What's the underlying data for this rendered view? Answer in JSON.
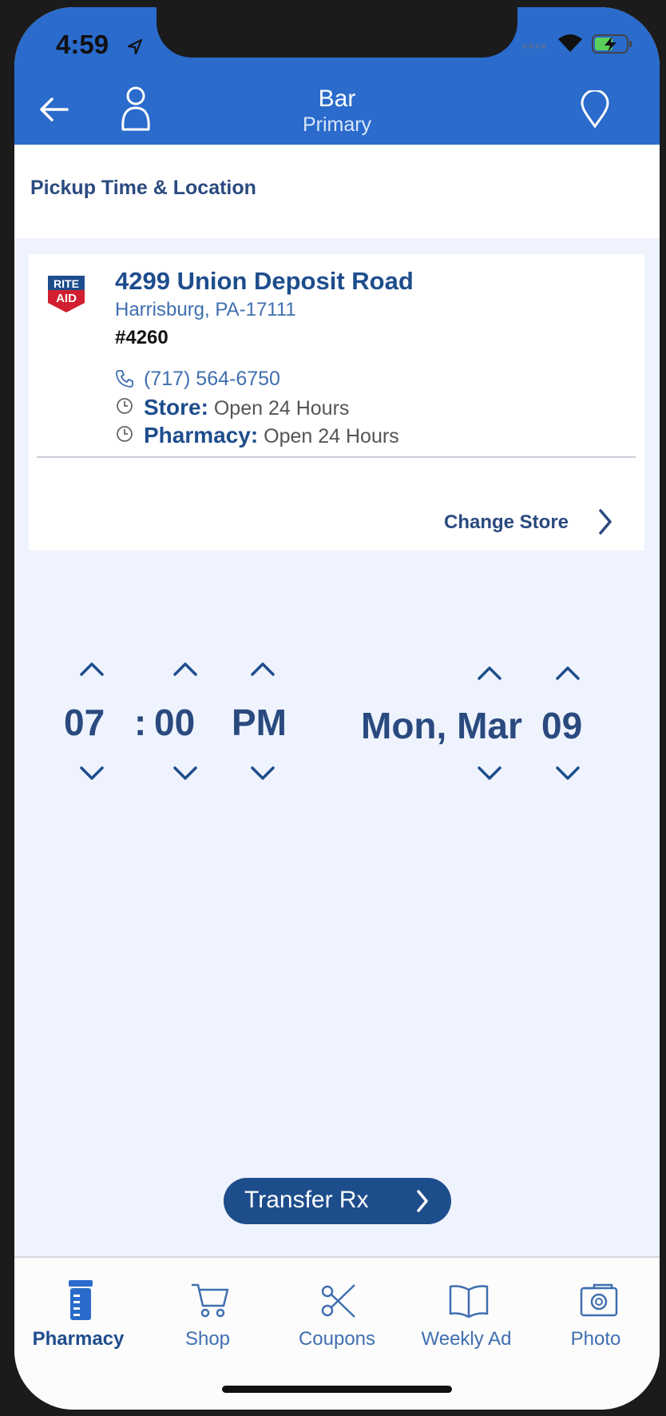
{
  "status": {
    "time": "4:59"
  },
  "header": {
    "title": "Bar",
    "subtitle": "Primary"
  },
  "section": {
    "title": "Pickup Time & Location"
  },
  "store": {
    "address": "4299 Union Deposit Road",
    "city": "Harrisburg, PA-17111",
    "number": "#4260",
    "phone": "(717) 564-6750",
    "store_label": "Store:",
    "store_hours": "Open 24 Hours",
    "pharmacy_label": "Pharmacy:",
    "pharmacy_hours": "Open 24 Hours",
    "change_label": "Change Store",
    "logo_top": "RITE",
    "logo_bottom": "AID"
  },
  "picker": {
    "hour": "07",
    "separator": ":",
    "minute": "00",
    "ampm": "PM",
    "day_month": "Mon, Mar",
    "date": "09"
  },
  "transfer": {
    "label": "Transfer Rx"
  },
  "tabs": [
    {
      "label": "Pharmacy",
      "icon": "pharmacy-icon",
      "active": true
    },
    {
      "label": "Shop",
      "icon": "cart-icon"
    },
    {
      "label": "Coupons",
      "icon": "scissors-icon"
    },
    {
      "label": "Weekly Ad",
      "icon": "book-icon"
    },
    {
      "label": "Photo",
      "icon": "camera-icon"
    }
  ],
  "colors": {
    "header_bg": "#2a6bcb",
    "primary": "#1e4d8c",
    "page_bg": "#eef3fd"
  }
}
